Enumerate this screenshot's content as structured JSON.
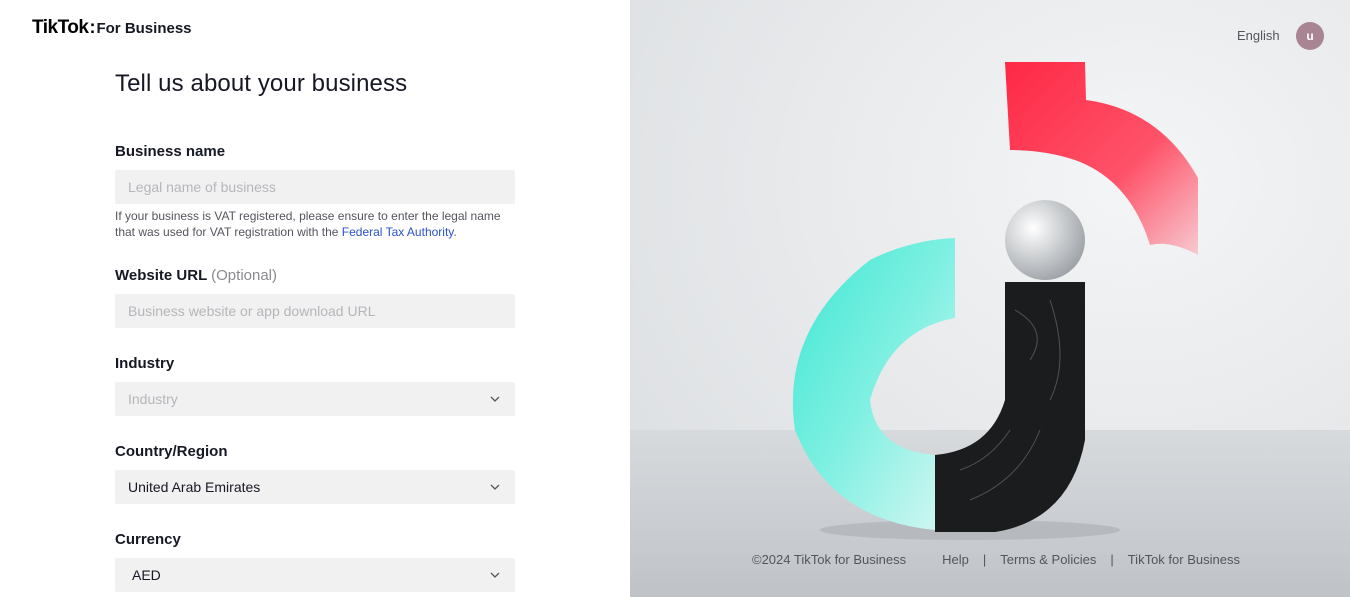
{
  "header": {
    "brand": "TikTok",
    "brand_separator": ":",
    "brand_suffix": "For Business",
    "language": "English",
    "avatar_initial": "u"
  },
  "form": {
    "title": "Tell us about your business",
    "business_name": {
      "label": "Business name",
      "placeholder": "Legal name of business",
      "value": "",
      "hint_text": "If your business is VAT registered, please ensure to enter the legal name that was used for VAT registration with the ",
      "hint_link": "Federal Tax Authority",
      "hint_end": "."
    },
    "website_url": {
      "label": "Website URL",
      "optional": "(Optional)",
      "placeholder": "Business website or app download URL",
      "value": ""
    },
    "industry": {
      "label": "Industry",
      "placeholder": "Industry"
    },
    "country_region": {
      "label": "Country/Region",
      "value": "United Arab Emirates"
    },
    "currency": {
      "label": "Currency",
      "value": "AED"
    }
  },
  "footer": {
    "copyright": "©2024 TikTok for Business",
    "links": [
      "Help",
      "Terms & Policies",
      "TikTok for Business"
    ],
    "separator": "|"
  },
  "icons": {
    "dropdown": "chevron-down-icon"
  }
}
